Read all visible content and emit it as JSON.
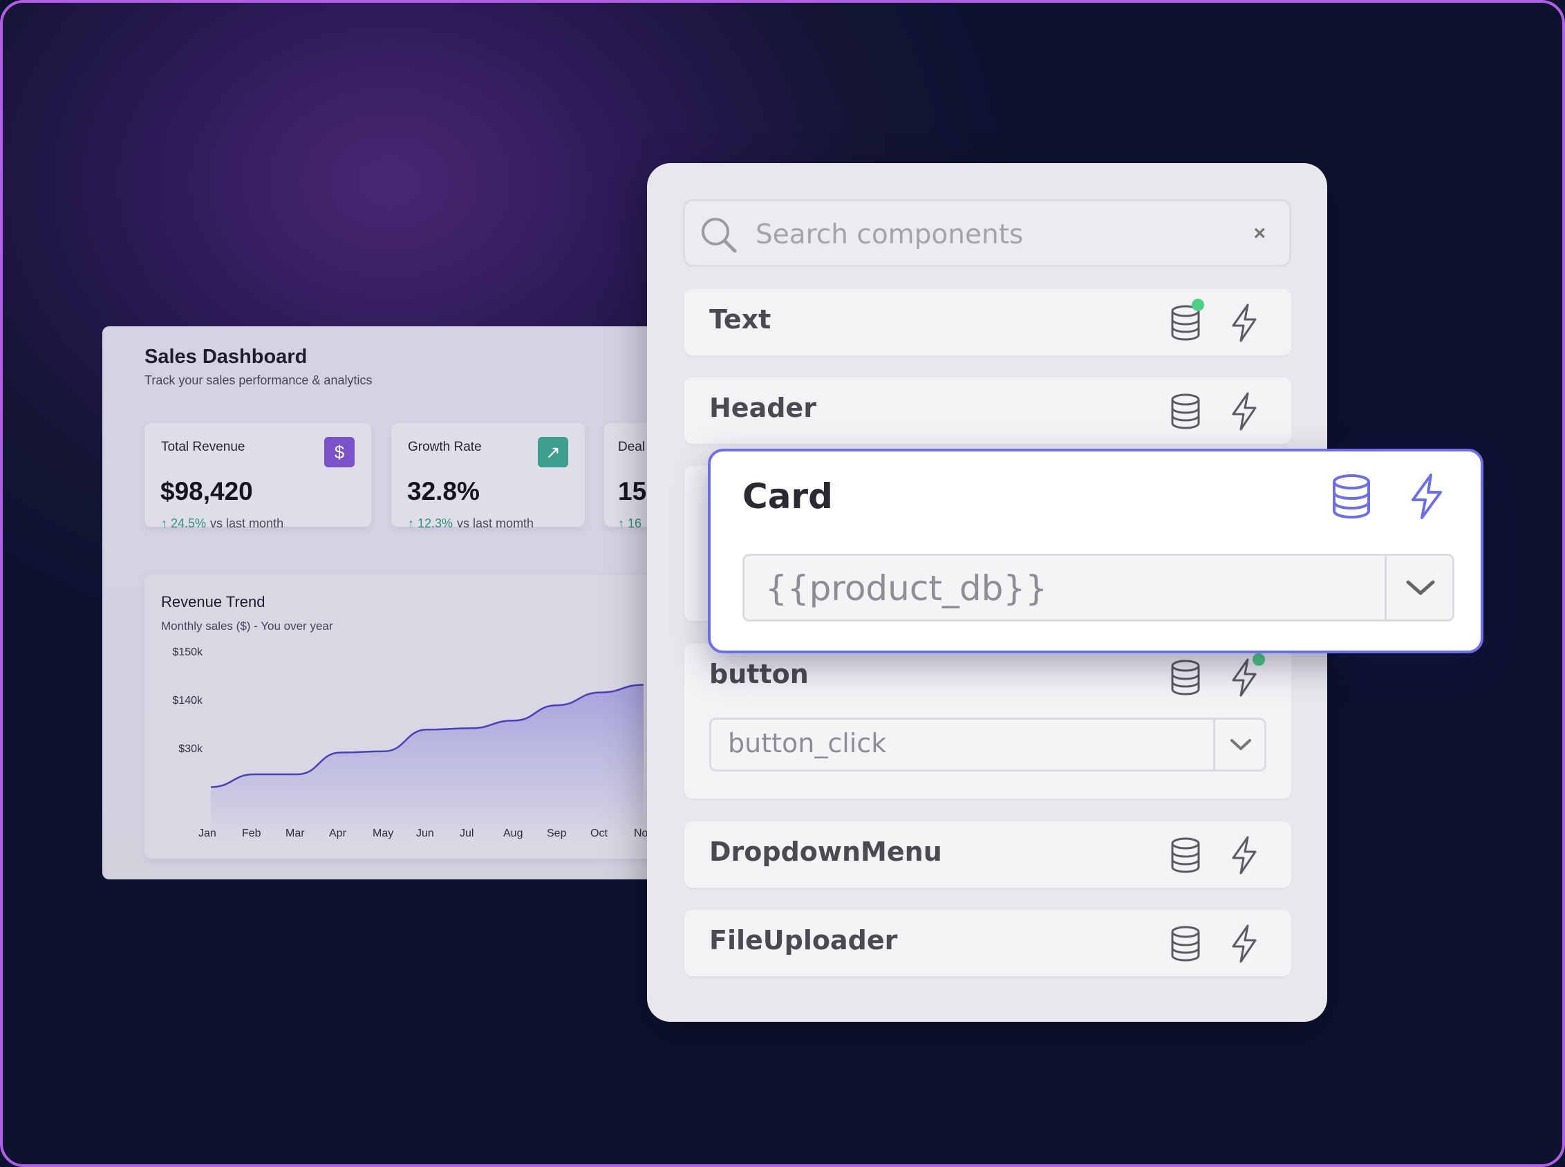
{
  "dashboard": {
    "title": "Sales Dashboard",
    "subtitle": "Track your sales performance & analytics",
    "kpis": [
      {
        "label": "Total Revenue",
        "value": "$98,420",
        "change": "↑ 24.5%",
        "vs": "vs last month",
        "icon": "dollar-icon",
        "icon_glyph": "$",
        "icon_color": "#7b52c7"
      },
      {
        "label": "Growth Rate",
        "value": "32.8%",
        "change": "↑ 12.3%",
        "vs": "vs   last momth",
        "icon": "trend-up-icon",
        "icon_glyph": "↗",
        "icon_color": "#3c9e8c"
      },
      {
        "label": "Deal",
        "value": "15",
        "change": "↑ 16",
        "vs": "",
        "icon": "",
        "icon_glyph": "",
        "icon_color": ""
      }
    ],
    "trend": {
      "title": "Revenue Trend",
      "subtitle": "Monthly sales ($) - You over year"
    }
  },
  "chart_data": {
    "type": "area",
    "title": "Revenue Trend",
    "subtitle": "Monthly sales ($) - You over year",
    "categories": [
      "Jan",
      "Feb",
      "Mar",
      "Apr",
      "May",
      "Jun",
      "Jul",
      "Aug",
      "Sep",
      "Oct",
      "No"
    ],
    "ytick_labels": [
      "$150k",
      "$140k",
      "$30k"
    ],
    "series": [
      {
        "values": [
          0.1,
          0.2,
          0.2,
          0.37,
          0.38,
          0.55,
          0.56,
          0.62,
          0.74,
          0.84,
          0.9
        ]
      }
    ],
    "color": "#4a3fb8",
    "grid": false,
    "legend": false
  },
  "panel": {
    "search": {
      "placeholder": "Search components",
      "value": "",
      "clear_glyph": "×"
    },
    "components": [
      {
        "name": "Text",
        "db_dot": true,
        "bolt_dot": false
      },
      {
        "name": "Header",
        "db_dot": false,
        "bolt_dot": false
      },
      {
        "name": "button",
        "db_dot": false,
        "bolt_dot": true,
        "select_value": "button_click"
      },
      {
        "name": "DropdownMenu",
        "db_dot": false,
        "bolt_dot": false
      },
      {
        "name": "FileUploader",
        "db_dot": false,
        "bolt_dot": false
      }
    ],
    "card": {
      "name": "Card",
      "select_value": "{{product_db}}"
    }
  },
  "colors": {
    "accent": "#6e6ee6",
    "status_dot": "#4fcf85",
    "positive": "#2e8f72"
  }
}
